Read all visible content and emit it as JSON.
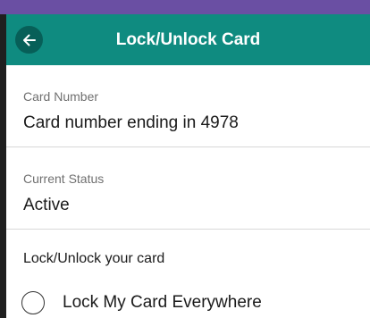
{
  "header": {
    "title": "Lock/Unlock Card",
    "back_icon": "arrow-left-icon"
  },
  "card_number": {
    "label": "Card Number",
    "value": "Card number ending in 4978"
  },
  "current_status": {
    "label": "Current Status",
    "value": "Active"
  },
  "lock_section": {
    "heading": "Lock/Unlock your card",
    "option_label": "Lock My Card Everywhere",
    "option_checked": false
  },
  "colors": {
    "background": "#6a4fa3",
    "header": "#0f8b80",
    "back_button": "#075f58"
  }
}
